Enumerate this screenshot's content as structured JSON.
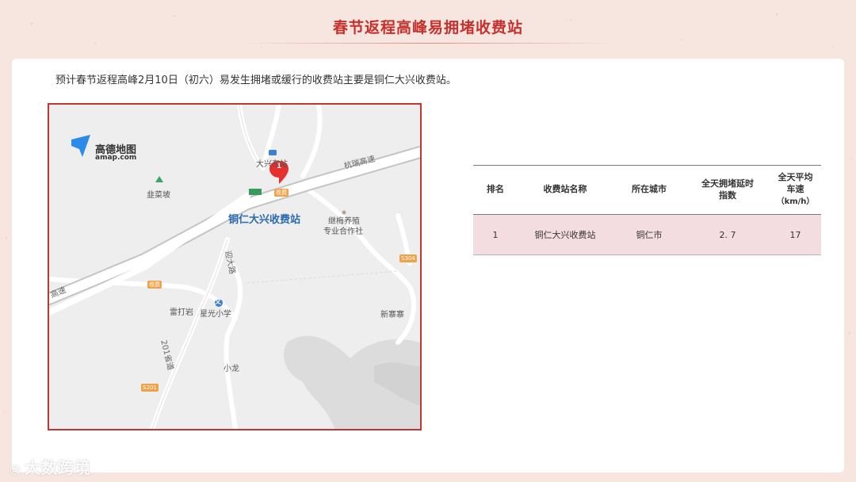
{
  "title": "春节返程高峰易拥堵收费站",
  "intro": "预计春节返程高峰2月10日（初六）易发生拥堵或缓行的收费站主要是铜仁大兴收费站。",
  "map": {
    "logo_brand": "高德地图",
    "logo_domain": "amap.com",
    "pin_number": "1",
    "labels": {
      "station_big": "铜仁大兴收费站",
      "daxing_station": "大兴东站",
      "hangrui_highway": "杭瑞高速",
      "highway_left": "高速",
      "jiucaipo": "韭菜坡",
      "cooperative_line1": "继梅养殖",
      "cooperative_line2": "专业合作社",
      "yingda_road": "迎大路",
      "leidazhai": "雷打岩",
      "xingguang_school": "星光小学",
      "national_road": "201省道",
      "xiaolong": "小龙",
      "xinshezhai": "新寨寨"
    },
    "toll_badge_main": "收费",
    "toll_badge_left": "收费",
    "road_shield_s201": "S201",
    "road_shield_right": "S304",
    "school_icon_glyph": "文"
  },
  "table": {
    "headers": {
      "rank": "排名",
      "name": "收费站名称",
      "city": "所在城市",
      "index_line1": "全天拥堵延时",
      "index_line2": "指数",
      "speed_line1": "全天平均",
      "speed_line2": "车速",
      "speed_line3": "（km/h）"
    },
    "rows": [
      {
        "rank": "1",
        "name": "铜仁大兴收费站",
        "city": "铜仁市",
        "index": "2. 7",
        "speed": "17"
      }
    ]
  },
  "watermark": "大数跨境",
  "colors": {
    "title_red": "#c7302c",
    "map_border": "#c33434",
    "row_pink": "#f4dde1",
    "background": "#f6e6df"
  }
}
